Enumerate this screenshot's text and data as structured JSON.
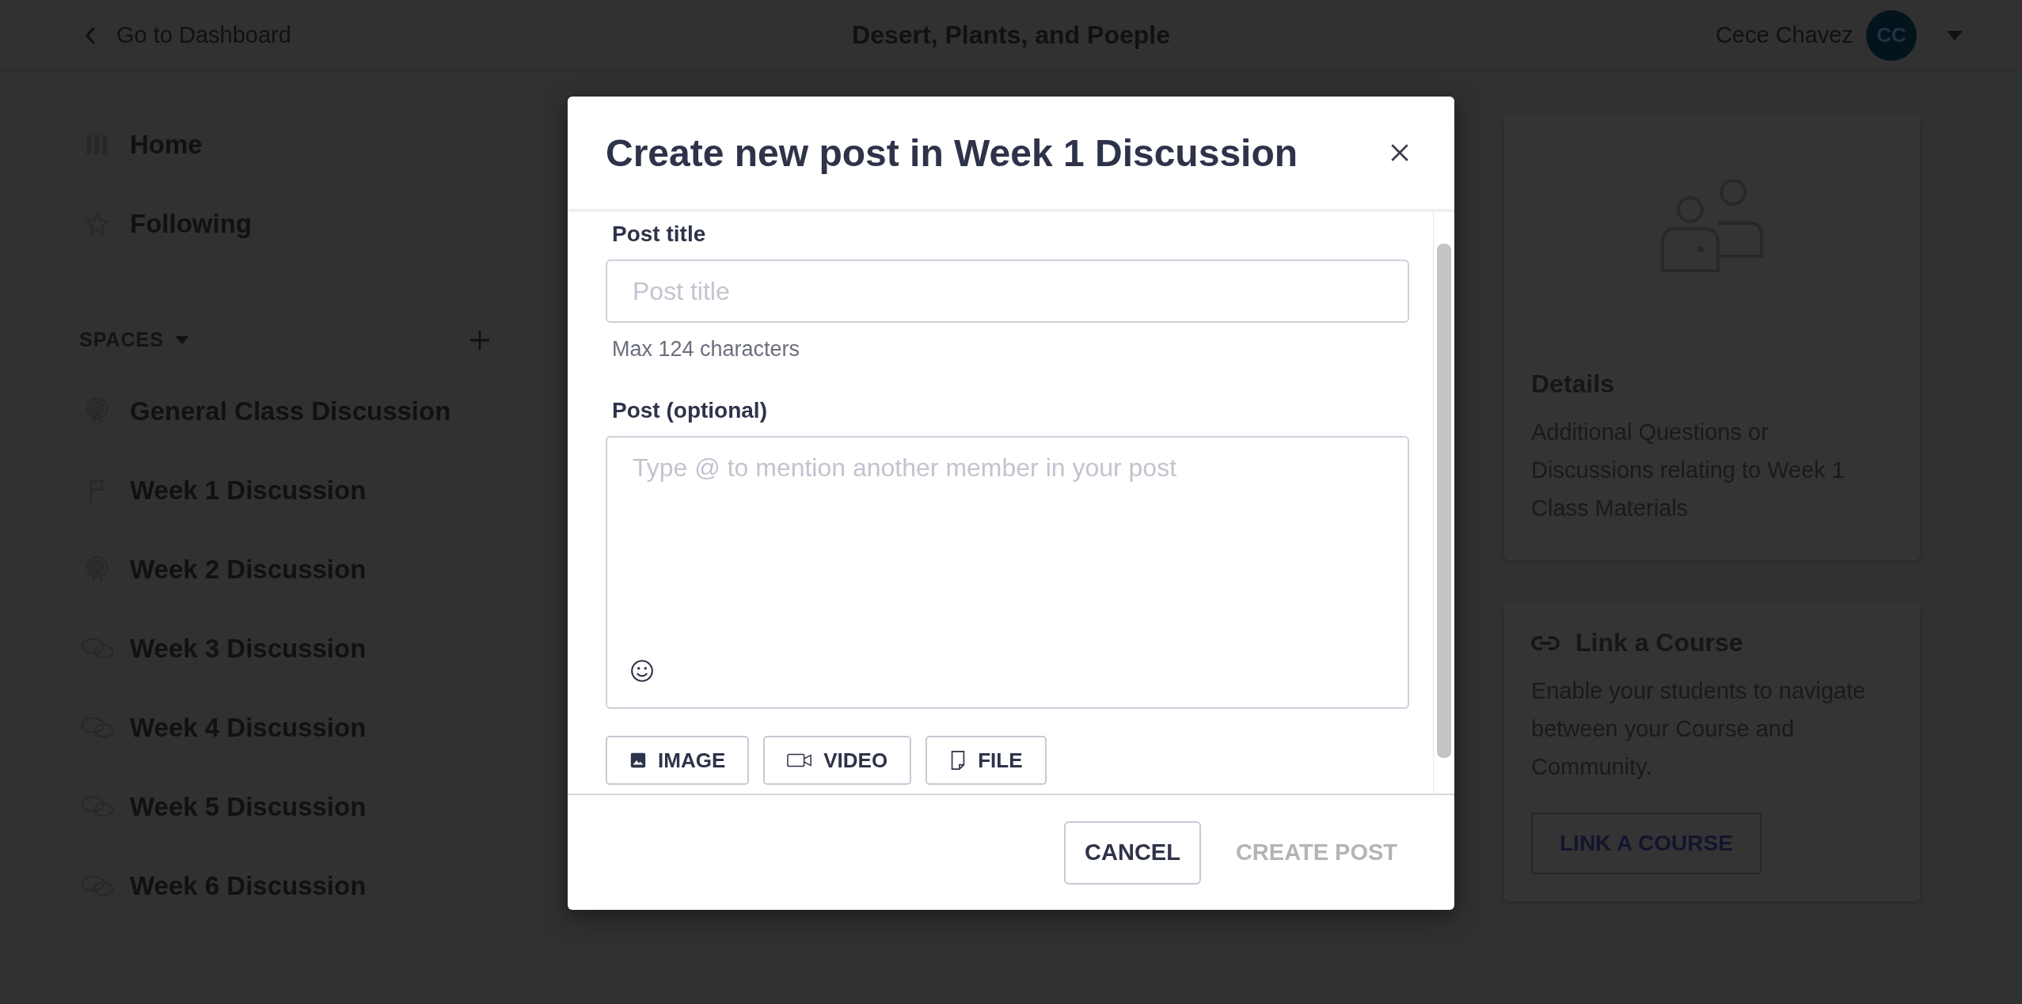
{
  "header": {
    "back_link": "Go to Dashboard",
    "title": "Desert, Plants, and Poeple",
    "user": {
      "name": "Cece Chavez",
      "initials": "CC"
    }
  },
  "sidebar": {
    "nav": [
      {
        "label": "Home",
        "kind": "grid"
      },
      {
        "label": "Following",
        "kind": "star"
      }
    ],
    "spaces_heading": "SPACES",
    "spaces": [
      {
        "label": "General Class Discussion",
        "kind": "broadcast"
      },
      {
        "label": "Week 1 Discussion",
        "kind": "flag"
      },
      {
        "label": "Week 2 Discussion",
        "kind": "broadcast"
      },
      {
        "label": "Week 3 Discussion",
        "kind": "chat"
      },
      {
        "label": "Week 4 Discussion",
        "kind": "chat"
      },
      {
        "label": "Week 5 Discussion",
        "kind": "chat"
      },
      {
        "label": "Week 6 Discussion",
        "kind": "chat"
      }
    ]
  },
  "modal": {
    "title": "Create new post in Week 1 Discussion",
    "post_title_label": "Post title",
    "post_title_placeholder": "Post title",
    "hint": "Max 124 characters",
    "post_label": "Post (optional)",
    "post_placeholder": "Type @ to mention another member in your post",
    "attachments": [
      {
        "label": "IMAGE",
        "kind": "image"
      },
      {
        "label": "VIDEO",
        "kind": "video"
      },
      {
        "label": "FILE",
        "kind": "file"
      }
    ],
    "cancel": "CANCEL",
    "create": "CREATE POST",
    "create_disabled": true
  },
  "details_card": {
    "title": "Details",
    "text": "Additional Questions or Discussions relating to Week 1 Class Materials"
  },
  "link_card": {
    "title": "Link a Course",
    "text": "Enable your students to navigate between your Course and Community.",
    "button": "LINK A COURSE"
  }
}
